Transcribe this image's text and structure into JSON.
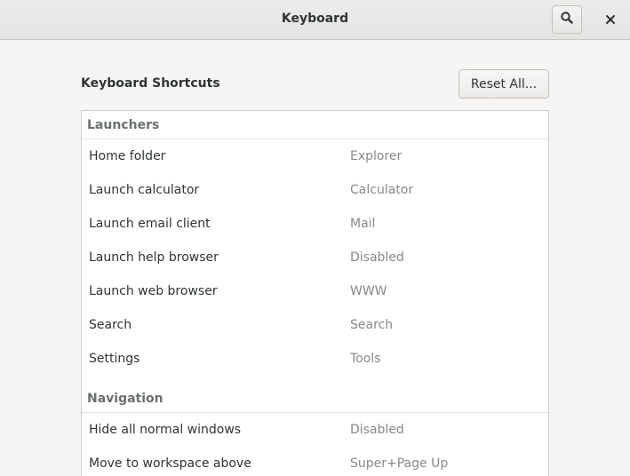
{
  "window": {
    "title": "Keyboard"
  },
  "header": {
    "search_icon": "search-icon",
    "close_icon": "close-icon"
  },
  "main": {
    "section_title": "Keyboard Shortcuts",
    "reset_label": "Reset All..."
  },
  "groups": [
    {
      "title": "Launchers",
      "items": [
        {
          "name": "Home folder",
          "shortcut": "Explorer"
        },
        {
          "name": "Launch calculator",
          "shortcut": "Calculator"
        },
        {
          "name": "Launch email client",
          "shortcut": "Mail"
        },
        {
          "name": "Launch help browser",
          "shortcut": "Disabled"
        },
        {
          "name": "Launch web browser",
          "shortcut": "WWW"
        },
        {
          "name": "Search",
          "shortcut": "Search"
        },
        {
          "name": "Settings",
          "shortcut": "Tools"
        }
      ]
    },
    {
      "title": "Navigation",
      "items": [
        {
          "name": "Hide all normal windows",
          "shortcut": "Disabled"
        },
        {
          "name": "Move to workspace above",
          "shortcut": "Super+Page Up"
        }
      ]
    }
  ]
}
